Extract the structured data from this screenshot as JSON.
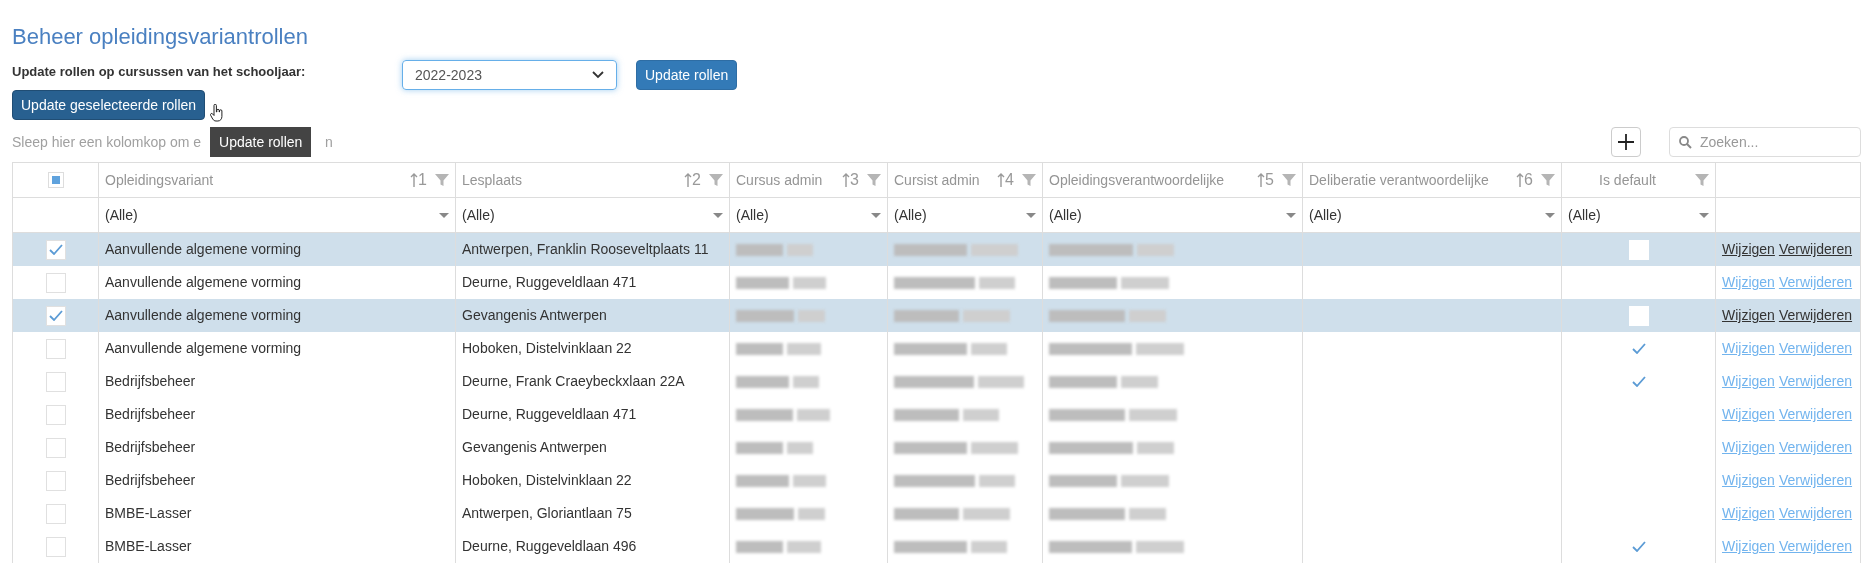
{
  "title": "Beheer opleidingsvariantrollen",
  "schoolyear": {
    "label": "Update rollen op cursussen van het schooljaar:",
    "value": "2022-2023",
    "button": "Update rollen"
  },
  "update_selected_button": {
    "label": "Update geselecteerde rollen",
    "hovered": true
  },
  "tooltip": "Update rollen",
  "group_hint": {
    "start": "Sleep hier een kolomkop om e",
    "end": "n"
  },
  "search": {
    "placeholder": "Zoeken..."
  },
  "header_checkbox": {
    "indeterminate": true
  },
  "columns": [
    {
      "label": "Opleidingsvariant",
      "sort": "1",
      "filter": "(Alle)"
    },
    {
      "label": "Lesplaats",
      "sort": "2",
      "filter": "(Alle)"
    },
    {
      "label": "Cursus admin",
      "sort": "3",
      "filter": "(Alle)"
    },
    {
      "label": "Cursist admin",
      "sort": "4",
      "filter": "(Alle)"
    },
    {
      "label": "Opleidingsverantwoordelijke",
      "sort": "5",
      "filter": "(Alle)"
    },
    {
      "label": "Deliberatie verantwoordelijke",
      "sort": "6",
      "filter": "(Alle)"
    },
    {
      "label": "Is default",
      "filter": "(Alle)"
    }
  ],
  "rows": [
    {
      "selected": true,
      "variant": "Aanvullende algemene vorming",
      "lesplaats": "Antwerpen, Franklin Rooseveltplaats 11",
      "redacted": true,
      "is_default": false,
      "edit": "Wijzigen",
      "delete": "Verwijderen"
    },
    {
      "selected": false,
      "variant": "Aanvullende algemene vorming",
      "lesplaats": "Deurne, Ruggeveldlaan 471",
      "redacted": true,
      "is_default": false,
      "edit": "Wijzigen",
      "delete": "Verwijderen"
    },
    {
      "selected": true,
      "variant": "Aanvullende algemene vorming",
      "lesplaats": "Gevangenis Antwerpen",
      "redacted": true,
      "is_default": false,
      "edit": "Wijzigen",
      "delete": "Verwijderen"
    },
    {
      "selected": false,
      "variant": "Aanvullende algemene vorming",
      "lesplaats": "Hoboken, Distelvinklaan 22",
      "redacted": true,
      "is_default": true,
      "edit": "Wijzigen",
      "delete": "Verwijderen"
    },
    {
      "selected": false,
      "variant": "Bedrijfsbeheer",
      "lesplaats": "Deurne, Frank Craeybeckxlaan 22A",
      "redacted": true,
      "is_default": true,
      "edit": "Wijzigen",
      "delete": "Verwijderen"
    },
    {
      "selected": false,
      "variant": "Bedrijfsbeheer",
      "lesplaats": "Deurne, Ruggeveldlaan 471",
      "redacted": true,
      "is_default": false,
      "edit": "Wijzigen",
      "delete": "Verwijderen"
    },
    {
      "selected": false,
      "variant": "Bedrijfsbeheer",
      "lesplaats": "Gevangenis Antwerpen",
      "redacted": true,
      "is_default": false,
      "edit": "Wijzigen",
      "delete": "Verwijderen"
    },
    {
      "selected": false,
      "variant": "Bedrijfsbeheer",
      "lesplaats": "Hoboken, Distelvinklaan 22",
      "redacted": true,
      "is_default": false,
      "edit": "Wijzigen",
      "delete": "Verwijderen"
    },
    {
      "selected": false,
      "variant": "BMBE-Lasser",
      "lesplaats": "Antwerpen, Gloriantlaan 75",
      "redacted": true,
      "is_default": false,
      "edit": "Wijzigen",
      "delete": "Verwijderen"
    },
    {
      "selected": false,
      "variant": "BMBE-Lasser",
      "lesplaats": "Deurne, Ruggeveldlaan 496",
      "redacted": true,
      "is_default": true,
      "edit": "Wijzigen",
      "delete": "Verwijderen"
    }
  ]
}
